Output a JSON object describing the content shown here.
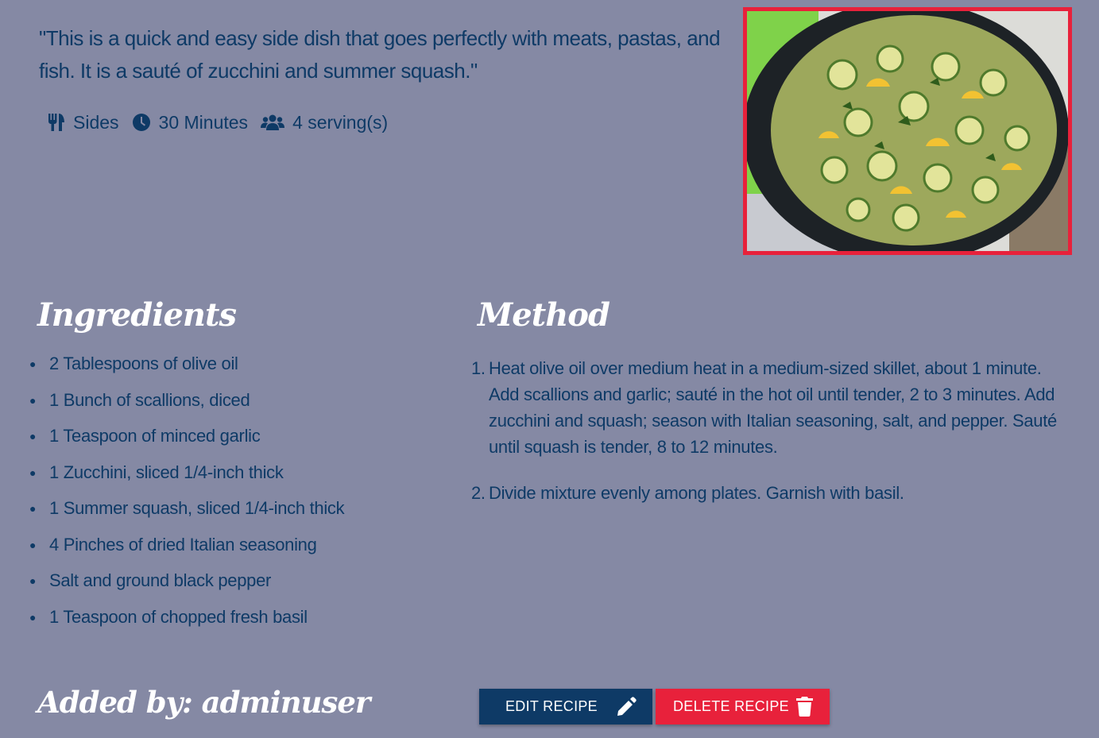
{
  "recipe": {
    "description": "\"This is a quick and easy side dish that goes perfectly with meats, pastas, and fish. It is a sauté of zucchini and summer squash.\"",
    "category": "Sides",
    "time": "30 Minutes",
    "servings": "4 serving(s)"
  },
  "icons": {
    "category": "utensils-icon",
    "time": "clock-icon",
    "servings": "users-icon",
    "edit": "pencil-icon",
    "delete": "trash-icon"
  },
  "ingredients": {
    "heading": "Ingredients",
    "items": [
      "2 Tablespoons of olive oil",
      "1 Bunch of scallions, diced",
      "1 Teaspoon of minced garlic",
      "1 Zucchini, sliced 1/4-inch thick",
      "1 Summer squash, sliced 1/4-inch thick",
      "4 Pinches of dried Italian seasoning",
      "Salt and ground black pepper",
      "1 Teaspoon of chopped fresh basil"
    ]
  },
  "method": {
    "heading": "Method",
    "steps": [
      {
        "num": "1.",
        "text": "Heat olive oil over medium heat in a medium-sized skillet, about 1 minute. Add scallions and garlic; sauté in the hot oil until tender, 2 to 3 minutes. Add zucchini and squash; season with Italian seasoning, salt, and pepper. Sauté until squash is tender, 8 to 12 minutes."
      },
      {
        "num": "2.",
        "text": "Divide mixture evenly among plates. Garnish with basil."
      }
    ]
  },
  "footer": {
    "added_by": "Added by: adminuser",
    "edit_label": "EDIT RECIPE",
    "delete_label": "DELETE RECIPE"
  },
  "colors": {
    "background": "#8589a4",
    "text": "#0e3a66",
    "accent_red": "#e8213b",
    "button_blue": "#0e3a66"
  }
}
